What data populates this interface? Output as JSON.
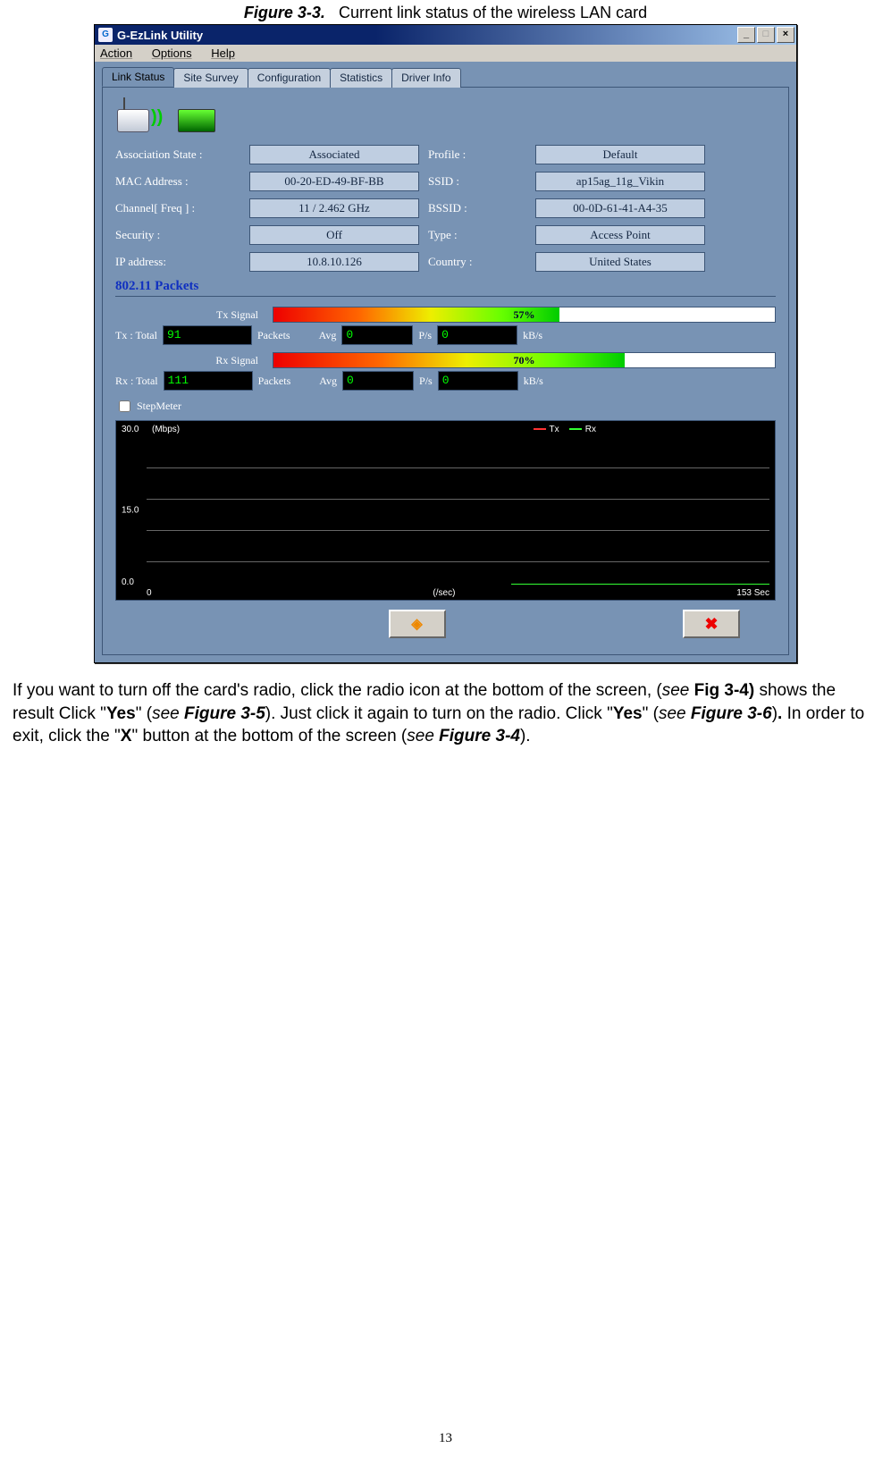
{
  "caption": {
    "fig": "Figure 3-3.",
    "text": "Current link status of the wireless LAN card"
  },
  "window": {
    "title": "G-EzLink Utility",
    "icon_letter": "G",
    "controls": {
      "min": "_",
      "max": "□",
      "close": "×"
    },
    "menu": [
      "Action",
      "Options",
      "Help"
    ],
    "tabs": [
      "Link Status",
      "Site Survey",
      "Configuration",
      "Statistics",
      "Driver Info"
    ],
    "active_tab": 0,
    "link": {
      "left": [
        {
          "label": "Association State :",
          "value": "Associated"
        },
        {
          "label": "MAC Address :",
          "value": "00-20-ED-49-BF-BB"
        },
        {
          "label": "Channel[ Freq ] :",
          "value": "11 / 2.462 GHz"
        },
        {
          "label": "Security :",
          "value": "Off"
        },
        {
          "label": "IP address:",
          "value": "10.8.10.126"
        }
      ],
      "right": [
        {
          "label": "Profile :",
          "value": "Default"
        },
        {
          "label": "SSID :",
          "value": "ap15ag_11g_Vikin"
        },
        {
          "label": "BSSID :",
          "value": "00-0D-61-41-A4-35"
        },
        {
          "label": "Type :",
          "value": "Access Point"
        },
        {
          "label": "Country :",
          "value": "United States"
        }
      ]
    },
    "packets": {
      "title": "802.11  Packets",
      "tx_signal_label": "Tx Signal",
      "tx_signal_pct": "57%",
      "tx_signal_pct_num": 57,
      "rx_signal_label": "Rx Signal",
      "rx_signal_pct": "70%",
      "rx_signal_pct_num": 70,
      "tx_row": {
        "prefix": "Tx :  Total",
        "total": "91",
        "unit1": "Packets",
        "avg_label": "Avg",
        "avg": "0",
        "unit2": "P/s",
        "rate": "0",
        "unit3": "kB/s"
      },
      "rx_row": {
        "prefix": "Rx :  Total",
        "total": "111",
        "unit1": "Packets",
        "avg_label": "Avg",
        "avg": "0",
        "unit2": "P/s",
        "rate": "0",
        "unit3": "kB/s"
      },
      "stepmeter": "StepMeter"
    },
    "graph": {
      "y_max": "30.0",
      "y_mid": "15.0",
      "y_min": "0.0",
      "unit": "(Mbps)",
      "legend_tx": "Tx",
      "legend_rx": "Rx",
      "x_left": "0",
      "x_unit": "(/sec)",
      "x_right": "153 Sec"
    },
    "buttons": {
      "radio_icon": "◈",
      "close_icon": "✖"
    }
  },
  "paragraph": {
    "p1": "If you want to turn off the card's radio, click the radio icon at the bottom of the screen, (",
    "see1": "see",
    "p2": " ",
    "b1": "Fig 3-4)",
    "p3": " shows the result Click \"",
    "b2": "Yes",
    "p4": "\" (",
    "see2": "see ",
    "bi1": "Figure 3-5",
    "p5": "). Just click it again to turn on the radio. Click \"",
    "b3": "Yes",
    "p6": "\" (",
    "see3": "see ",
    "bi2": "Figure 3-6",
    "p6b": ")",
    "b4": ".",
    "p7": " In order to exit, click the \"",
    "b5": "X",
    "p8": "\" button at the bottom of the screen (",
    "see4": "see ",
    "bi3": "Figure 3-4",
    "p9": ")."
  },
  "page_number": "13"
}
